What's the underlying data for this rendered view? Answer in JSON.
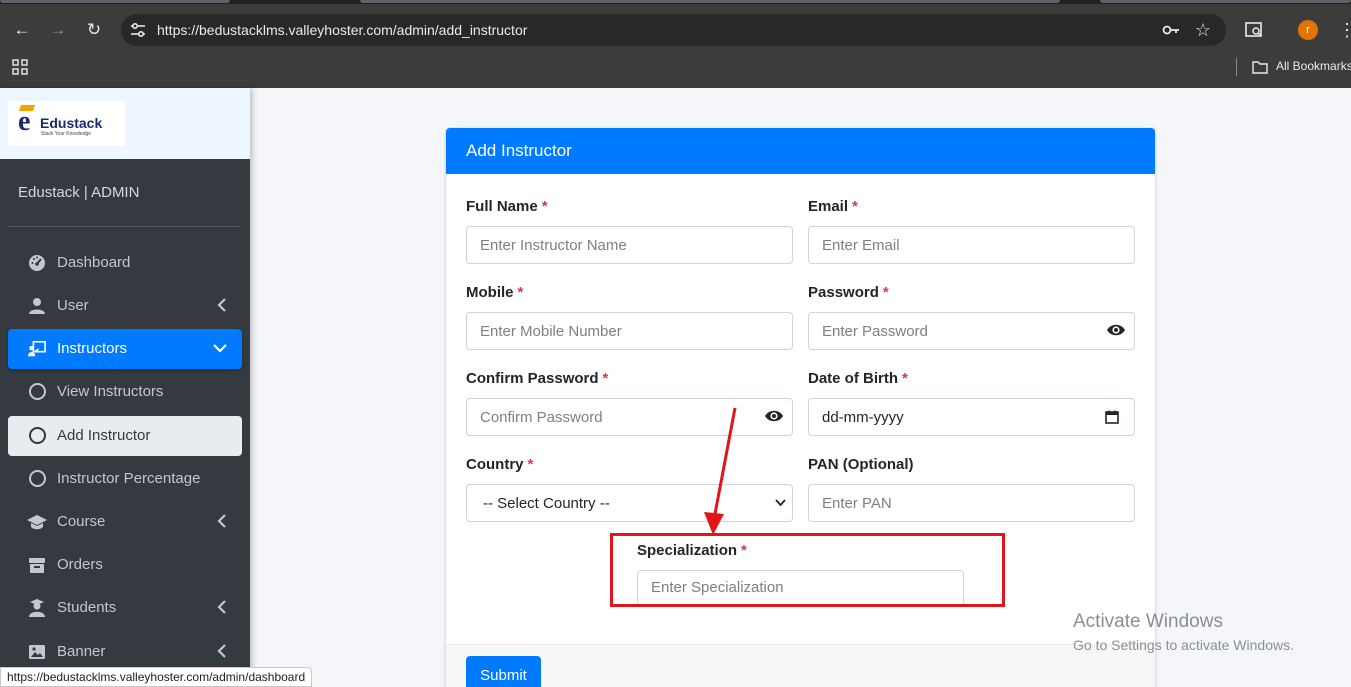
{
  "browser": {
    "url": "https://bedustacklms.valleyhoster.com/admin/add_instructor",
    "profile_initial": "r",
    "bookmarks_label": "All Bookmarks",
    "status_url": "https://bedustacklms.valleyhoster.com/admin/dashboard"
  },
  "brand": {
    "logo_letter": "e",
    "logo_name": "Edustack",
    "logo_tagline": "Stack Your Knowledge",
    "admin_title": "Edustack | ADMIN"
  },
  "sidebar": {
    "items": [
      {
        "label": "Dashboard",
        "icon": "dashboard-icon"
      },
      {
        "label": "User",
        "icon": "user-icon"
      },
      {
        "label": "Instructors",
        "icon": "chalkboard-teacher-icon"
      },
      {
        "label": "View Instructors",
        "icon": "circle-icon"
      },
      {
        "label": "Add Instructor",
        "icon": "circle-icon"
      },
      {
        "label": "Instructor Percentage",
        "icon": "circle-icon"
      },
      {
        "label": "Course",
        "icon": "graduation-cap-icon"
      },
      {
        "label": "Orders",
        "icon": "box-icon"
      },
      {
        "label": "Students",
        "icon": "user-graduate-icon"
      },
      {
        "label": "Banner",
        "icon": "image-icon"
      }
    ]
  },
  "form": {
    "title": "Add Instructor",
    "full_name": {
      "label": "Full Name",
      "placeholder": "Enter Instructor Name"
    },
    "email": {
      "label": "Email",
      "placeholder": "Enter Email"
    },
    "mobile": {
      "label": "Mobile",
      "placeholder": "Enter Mobile Number"
    },
    "password": {
      "label": "Password",
      "placeholder": "Enter Password"
    },
    "confirm_password": {
      "label": "Confirm Password",
      "placeholder": "Confirm Password"
    },
    "dob": {
      "label": "Date of Birth",
      "value": "dd-mm-yyyy"
    },
    "country": {
      "label": "Country",
      "selected": "-- Select Country --"
    },
    "pan": {
      "label": "PAN (Optional)",
      "placeholder": "Enter PAN"
    },
    "specialization": {
      "label": "Specialization",
      "placeholder": "Enter Specialization"
    },
    "required_mark": "*",
    "submit_label": "Submit"
  },
  "watermark": {
    "line1": "Activate Windows",
    "line2": "Go to Settings to activate Windows."
  },
  "colors": {
    "primary": "#007bff",
    "sidebar_bg": "#343a40",
    "required": "#dc3545",
    "annotation": "#e0161b"
  }
}
